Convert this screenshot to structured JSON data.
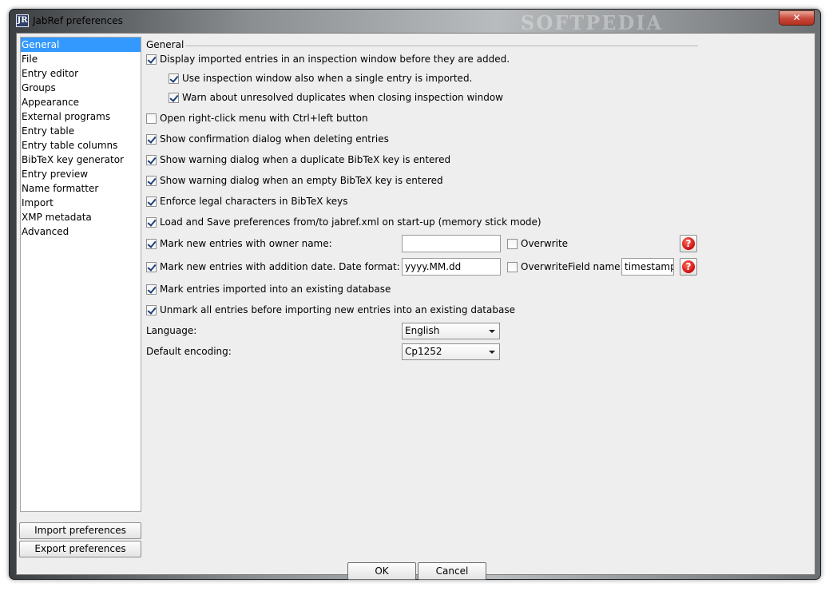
{
  "window": {
    "title": "JabRef preferences",
    "watermark": "SOFTPEDIA",
    "close_glyph": "✕",
    "icon_text": "JR"
  },
  "sidebar": {
    "items": [
      "General",
      "File",
      "Entry editor",
      "Groups",
      "Appearance",
      "External programs",
      "Entry table",
      "Entry table columns",
      "BibTeX key generator",
      "Entry preview",
      "Name formatter",
      "Import",
      "XMP metadata",
      "Advanced"
    ],
    "selected": "General",
    "import_label": "Import preferences",
    "export_label": "Export preferences"
  },
  "general": {
    "group_title": "General",
    "display_imported": {
      "label": "Display imported entries in an inspection window before they are added.",
      "checked": true
    },
    "use_inspection_single": {
      "label": "Use inspection window also when a single entry is imported.",
      "checked": true
    },
    "warn_duplicates": {
      "label": "Warn about unresolved duplicates when closing inspection window",
      "checked": true
    },
    "right_click_menu": {
      "label": "Open right-click menu with Ctrl+left button",
      "checked": false
    },
    "confirm_delete": {
      "label": "Show confirmation dialog when deleting entries",
      "checked": true
    },
    "warn_duplicate_key": {
      "label": "Show warning dialog when a duplicate BibTeX key is entered",
      "checked": true
    },
    "warn_empty_key": {
      "label": "Show warning dialog when an empty BibTeX key is entered",
      "checked": true
    },
    "enforce_legal": {
      "label": "Enforce legal characters in BibTeX keys",
      "checked": true
    },
    "memory_stick": {
      "label": "Load and Save preferences from/to jabref.xml on start-up (memory stick mode)",
      "checked": true
    },
    "mark_owner": {
      "label": "Mark new entries with owner name:",
      "checked": true,
      "value": "",
      "overwrite_label": "Overwrite",
      "overwrite_checked": false
    },
    "mark_date": {
      "label": "Mark new entries with addition date. Date format:",
      "checked": true,
      "value": "yyyy.MM.dd",
      "overwrite_label": "Overwrite",
      "overwrite_checked": false,
      "field_name_label": "Field name:",
      "field_name_value": "timestamp"
    },
    "mark_imported": {
      "label": "Mark entries imported into an existing database",
      "checked": true
    },
    "unmark_all": {
      "label": "Unmark all entries before importing new entries into an existing database",
      "checked": true
    },
    "language": {
      "label": "Language:",
      "value": "English"
    },
    "encoding": {
      "label": "Default encoding:",
      "value": "Cp1252"
    },
    "help_glyph": "?"
  },
  "buttons": {
    "ok": "OK",
    "cancel": "Cancel"
  },
  "colors": {
    "selection": "#3399ff",
    "close": "#c9463a",
    "help": "#cc0f0f"
  }
}
